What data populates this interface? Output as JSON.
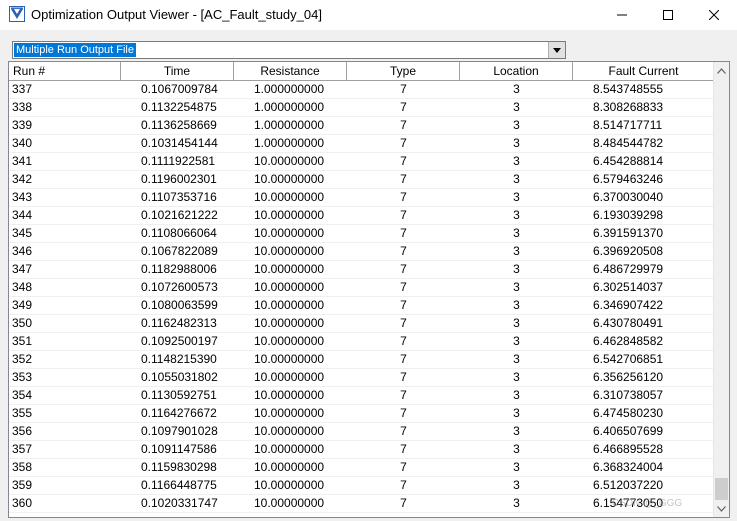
{
  "window": {
    "title": "Optimization Output Viewer - [AC_Fault_study_04]",
    "icon": "app-logo-icon"
  },
  "combo": {
    "selected": "Multiple Run Output File"
  },
  "table": {
    "columns": [
      "Run #",
      "Time",
      "Resistance",
      "Type",
      "Location",
      "Fault Current"
    ],
    "rows": [
      [
        "337",
        "0.1067009784",
        "1.000000000",
        "7",
        "3",
        "8.543748555"
      ],
      [
        "338",
        "0.1132254875",
        "1.000000000",
        "7",
        "3",
        "8.308268833"
      ],
      [
        "339",
        "0.1136258669",
        "1.000000000",
        "7",
        "3",
        "8.514717711"
      ],
      [
        "340",
        "0.1031454144",
        "1.000000000",
        "7",
        "3",
        "8.484544782"
      ],
      [
        "341",
        "0.1111922581",
        "10.00000000",
        "7",
        "3",
        "6.454288814"
      ],
      [
        "342",
        "0.1196002301",
        "10.00000000",
        "7",
        "3",
        "6.579463246"
      ],
      [
        "343",
        "0.1107353716",
        "10.00000000",
        "7",
        "3",
        "6.370030040"
      ],
      [
        "344",
        "0.1021621222",
        "10.00000000",
        "7",
        "3",
        "6.193039298"
      ],
      [
        "345",
        "0.1108066064",
        "10.00000000",
        "7",
        "3",
        "6.391591370"
      ],
      [
        "346",
        "0.1067822089",
        "10.00000000",
        "7",
        "3",
        "6.396920508"
      ],
      [
        "347",
        "0.1182988006",
        "10.00000000",
        "7",
        "3",
        "6.486729979"
      ],
      [
        "348",
        "0.1072600573",
        "10.00000000",
        "7",
        "3",
        "6.302514037"
      ],
      [
        "349",
        "0.1080063599",
        "10.00000000",
        "7",
        "3",
        "6.346907422"
      ],
      [
        "350",
        "0.1162482313",
        "10.00000000",
        "7",
        "3",
        "6.430780491"
      ],
      [
        "351",
        "0.1092500197",
        "10.00000000",
        "7",
        "3",
        "6.462848582"
      ],
      [
        "352",
        "0.1148215390",
        "10.00000000",
        "7",
        "3",
        "6.542706851"
      ],
      [
        "353",
        "0.1055031802",
        "10.00000000",
        "7",
        "3",
        "6.356256120"
      ],
      [
        "354",
        "0.1130592751",
        "10.00000000",
        "7",
        "3",
        "6.310738057"
      ],
      [
        "355",
        "0.1164276672",
        "10.00000000",
        "7",
        "3",
        "6.474580230"
      ],
      [
        "356",
        "0.1097901028",
        "10.00000000",
        "7",
        "3",
        "6.406507699"
      ],
      [
        "357",
        "0.1091147586",
        "10.00000000",
        "7",
        "3",
        "6.466895528"
      ],
      [
        "358",
        "0.1159830298",
        "10.00000000",
        "7",
        "3",
        "6.368324004"
      ],
      [
        "359",
        "0.1166448775",
        "10.00000000",
        "7",
        "3",
        "6.512037220"
      ],
      [
        "360",
        "0.1020331747",
        "10.00000000",
        "7",
        "3",
        "6.154773050"
      ]
    ]
  },
  "watermark": "CSDN @_GGG",
  "colors": {
    "selection": "#0078d7",
    "icon_blue": "#2b5fb3"
  }
}
